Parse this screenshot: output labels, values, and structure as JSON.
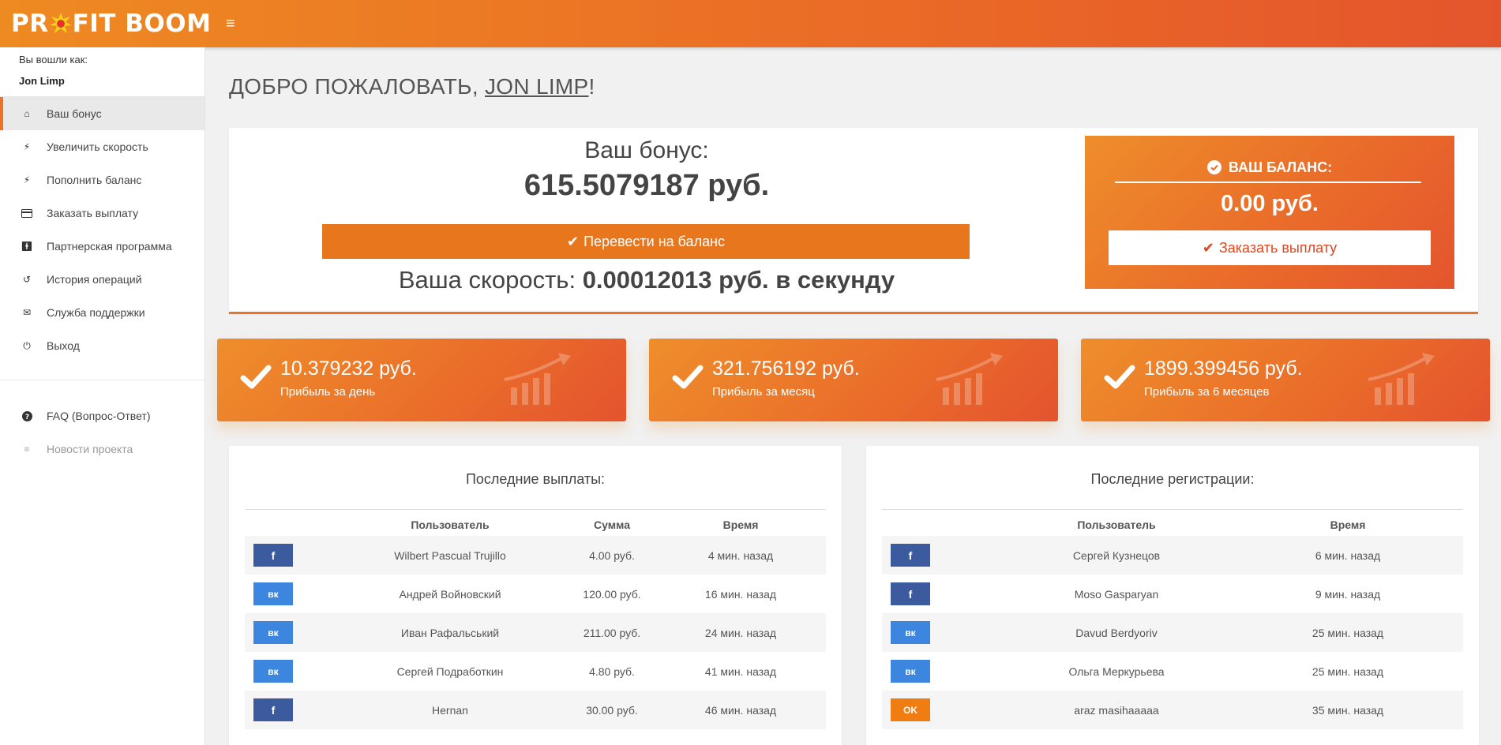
{
  "header": {
    "logo_left": "PR",
    "logo_right": "FIT BOOM",
    "menu_icon": "hamburger-icon"
  },
  "sidebar": {
    "login_label": "Вы вошли как:",
    "login_name": "Jon Limp",
    "items": [
      {
        "label": "Ваш бонус",
        "icon": "home-icon"
      },
      {
        "label": "Увеличить скорость",
        "icon": "bolt-icon"
      },
      {
        "label": "Пополнить баланс",
        "icon": "bolt-icon"
      },
      {
        "label": "Заказать выплату",
        "icon": "credit-card-icon"
      },
      {
        "label": "Партнерская программа",
        "icon": "person-icon"
      },
      {
        "label": "История операций",
        "icon": "history-icon"
      },
      {
        "label": "Служба поддержки",
        "icon": "envelope-icon"
      },
      {
        "label": "Выход",
        "icon": "power-icon"
      }
    ],
    "extra": [
      {
        "label": "FAQ (Вопрос-Ответ)",
        "icon": "question-icon"
      },
      {
        "label": "Новости проекта",
        "icon": "list-icon"
      }
    ]
  },
  "welcome": {
    "prefix": "ДОБРО ПОЖАЛОВАТЬ, ",
    "name": "JON LIMP",
    "suffix": "!"
  },
  "bonus": {
    "title": "Ваш бонус:",
    "value": "615.5079187 руб.",
    "transfer_label": "Перевести на баланс",
    "speed_label": "Ваша скорость: ",
    "speed_value": "0.00012013 руб. в секунду"
  },
  "balance": {
    "title": "ВАШ БАЛАНС:",
    "value": "0.00 руб.",
    "withdraw_label": "Заказать выплату"
  },
  "stats": [
    {
      "value": "10.379232 руб.",
      "label": "Прибыль за день"
    },
    {
      "value": "321.756192 руб.",
      "label": "Прибыль за месяц"
    },
    {
      "value": "1899.399456 руб.",
      "label": "Прибыль за 6 месяцев"
    }
  ],
  "payouts": {
    "title": "Последние выплаты:",
    "columns": [
      "Пользователь",
      "Сумма",
      "Время"
    ],
    "rows": [
      {
        "network": "fb",
        "user": "Wilbert Pascual Trujillo",
        "amount": "4.00 руб.",
        "time": "4 мин. назад"
      },
      {
        "network": "vk",
        "user": "Андрей Войновский",
        "amount": "120.00 руб.",
        "time": "16 мин. назад"
      },
      {
        "network": "vk",
        "user": "Иван Рафальський",
        "amount": "211.00 руб.",
        "time": "24 мин. назад"
      },
      {
        "network": "vk",
        "user": "Сергей Подработкин",
        "amount": "4.80 руб.",
        "time": "41 мин. назад"
      },
      {
        "network": "fb",
        "user": "Hernan",
        "amount": "30.00 руб.",
        "time": "46 мин. назад"
      }
    ]
  },
  "registrations": {
    "title": "Последние регистрации:",
    "columns": [
      "Пользователь",
      "Время"
    ],
    "rows": [
      {
        "network": "fb",
        "user": "Сергей Кузнецов",
        "time": "6 мин. назад"
      },
      {
        "network": "fb",
        "user": "Moso Gasparyan",
        "time": "9 мин. назад"
      },
      {
        "network": "vk",
        "user": "Davud Berdyoriv",
        "time": "25 мин. назад"
      },
      {
        "network": "vk",
        "user": "Ольга Меркурьева",
        "time": "25 мин. назад"
      },
      {
        "network": "ok",
        "user": "araz masihaaaaa",
        "time": "35 мин. назад"
      }
    ]
  },
  "social_glyphs": {
    "fb": "f",
    "vk": "вк",
    "ok": "OK"
  },
  "colors": {
    "accent": "#e97428",
    "fb": "#3b5b9e",
    "vk": "#3d86e0",
    "ok": "#ef7d12"
  }
}
